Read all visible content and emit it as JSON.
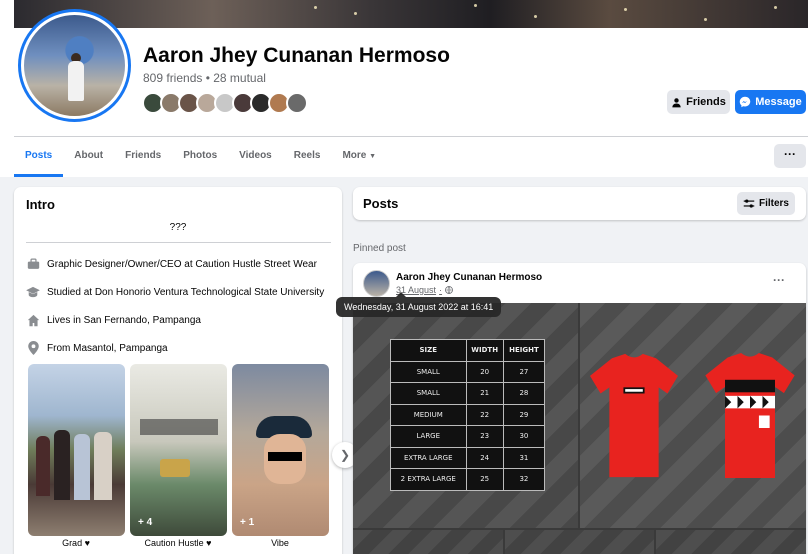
{
  "profile": {
    "name": "Aaron Jhey Cunanan Hermoso",
    "friends_summary": "809 friends • 28 mutual",
    "friend_avatar_colors": [
      "#3a4a3c",
      "#8a7a6a",
      "#6a5448",
      "#b9a89a",
      "#c8c8c8",
      "#4a3a3a",
      "#2a2a2a",
      "#b07a50",
      "#6a6a6a"
    ]
  },
  "actions": {
    "friends_label": "Friends",
    "message_label": "Message",
    "more_label": "···"
  },
  "tabs": [
    {
      "label": "Posts"
    },
    {
      "label": "About"
    },
    {
      "label": "Friends"
    },
    {
      "label": "Photos"
    },
    {
      "label": "Videos"
    },
    {
      "label": "Reels"
    },
    {
      "label": "More"
    }
  ],
  "intro": {
    "title": "Intro",
    "bio": "???",
    "rows": [
      {
        "icon": "briefcase-icon",
        "text": "Graphic Designer/Owner/CEO at Caution Hustle Street Wear"
      },
      {
        "icon": "graduation-cap-icon",
        "text": "Studied at Don Honorio Ventura Technological State University"
      },
      {
        "icon": "home-icon",
        "text": "Lives in San Fernando, Pampanga"
      },
      {
        "icon": "location-pin-icon",
        "text": "From Masantol, Pampanga"
      }
    ],
    "featured": [
      {
        "label": "Grad ♥",
        "count": ""
      },
      {
        "label": "Caution Hustle ♥",
        "count": "+ 4"
      },
      {
        "label": "Vibe",
        "count": "+ 1"
      }
    ]
  },
  "posts": {
    "title": "Posts",
    "filters_label": "Filters",
    "pinned_label": "Pinned post",
    "pinned": {
      "author": "Aaron Jhey Cunanan Hermoso",
      "date": "31 August",
      "tooltip": "Wednesday, 31 August 2022 at 16:41",
      "size_chart": {
        "headers": [
          "SIZE",
          "WIDTH",
          "HEIGHT"
        ],
        "rows": [
          [
            "SMALL",
            "20",
            "27"
          ],
          [
            "SMALL",
            "21",
            "28"
          ],
          [
            "MEDIUM",
            "22",
            "29"
          ],
          [
            "LARGE",
            "23",
            "30"
          ],
          [
            "EXTRA LARGE",
            "24",
            "31"
          ],
          [
            "2 EXTRA LARGE",
            "25",
            "32"
          ]
        ]
      }
    }
  },
  "colors": {
    "accent": "#1877f2",
    "shirt": "#e8231f"
  }
}
